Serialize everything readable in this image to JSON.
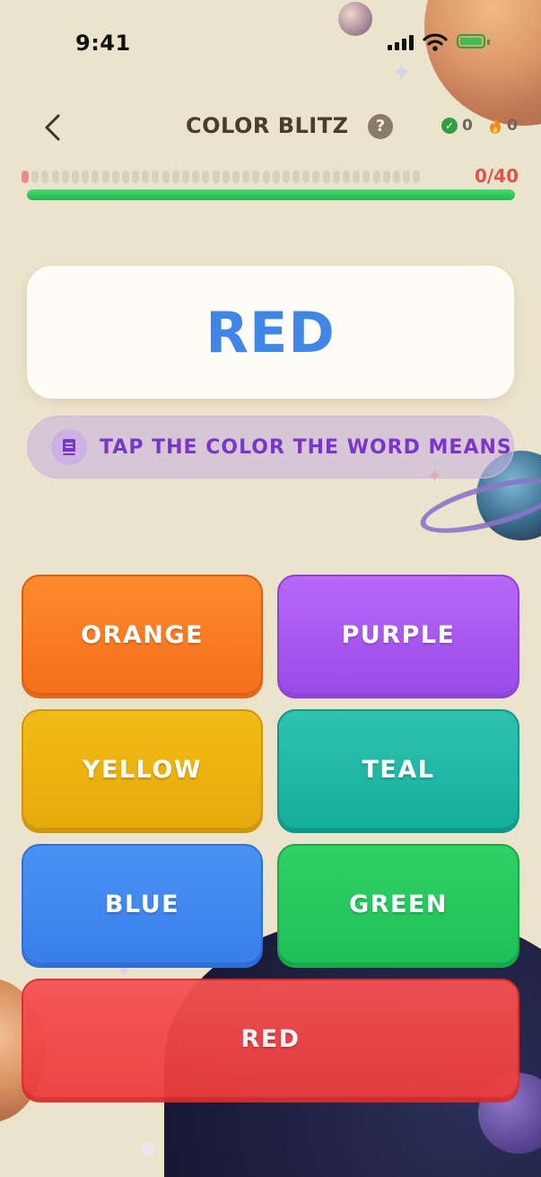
{
  "status_bar": {
    "time": "9:41"
  },
  "header": {
    "title": "COLOR BLITZ",
    "help_symbol": "?",
    "correct_count": "0",
    "streak_count": "0",
    "back_icon": "chevron-left-icon",
    "help_icon": "question-mark-icon",
    "correct_icon": "check-circle-icon",
    "streak_icon": "flame-icon"
  },
  "progress": {
    "current": 0,
    "total": 40,
    "count_text": "0/40",
    "bar_fill_fraction": 1.0
  },
  "prompt": {
    "word": "RED",
    "word_color": "#3f86e6"
  },
  "instruction": {
    "text": "TAP THE COLOR THE WORD MEANS",
    "icon": "book-icon"
  },
  "answers": [
    {
      "label": "ORANGE",
      "color": "#f97a22"
    },
    {
      "label": "PURPLE",
      "color": "#a85af0"
    },
    {
      "label": "YELLOW",
      "color": "#ebb111"
    },
    {
      "label": "TEAL",
      "color": "#1db8a3"
    },
    {
      "label": "BLUE",
      "color": "#4086ef"
    },
    {
      "label": "GREEN",
      "color": "#27c65d"
    },
    {
      "label": "RED",
      "color": "#f04848"
    }
  ],
  "colors": {
    "background": "#ebe3cb",
    "title": "#4b3b2b",
    "progress_text": "#e0534c",
    "progress_fill": "#2ec95c",
    "instruction_text": "#7a36c9"
  }
}
